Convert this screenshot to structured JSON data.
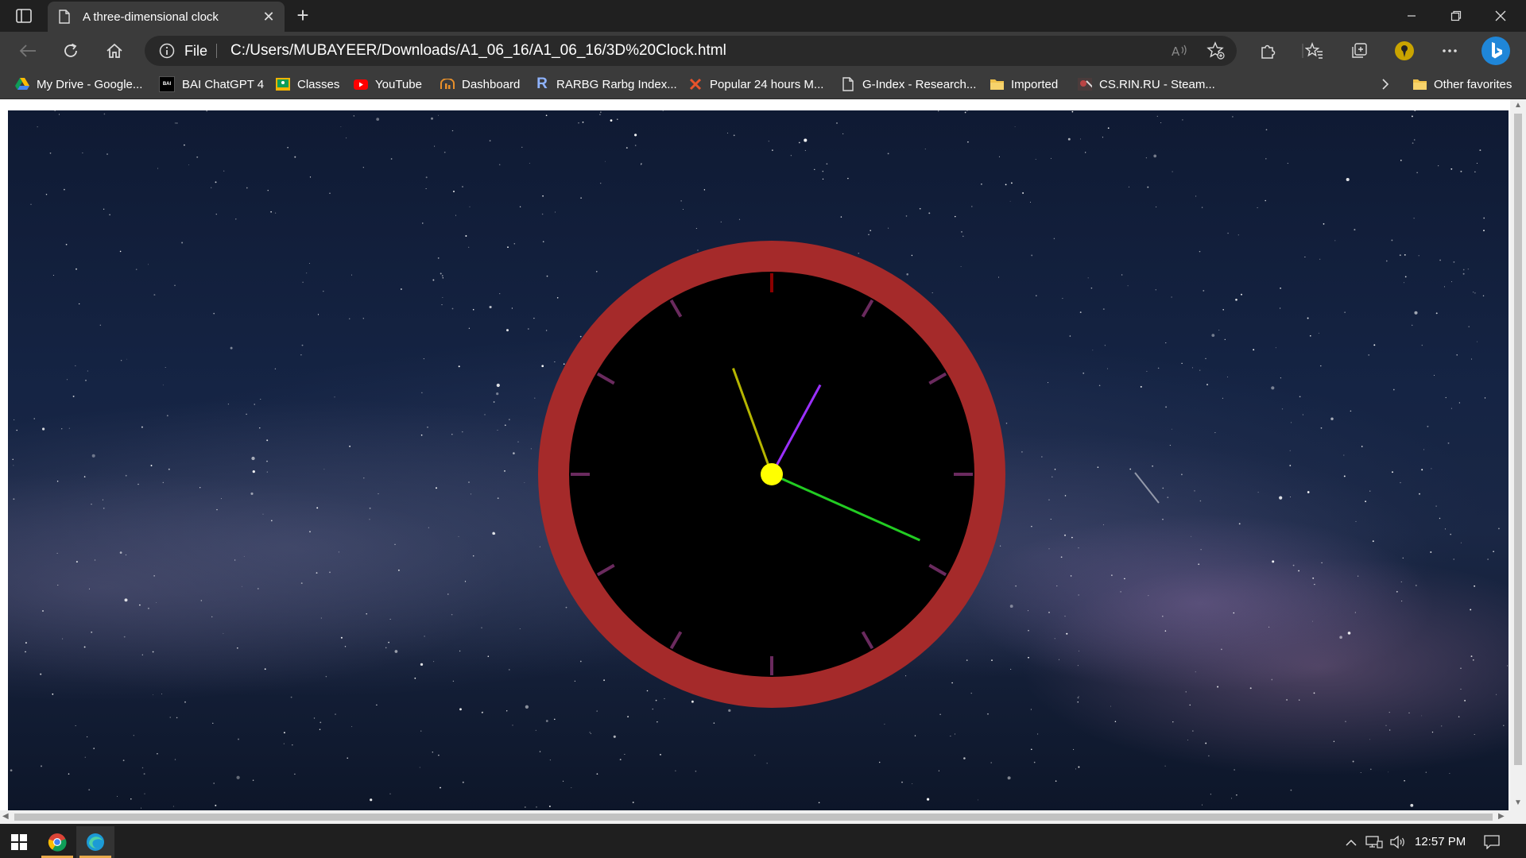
{
  "window": {
    "tab_title": "A three-dimensional clock",
    "tab_icon": "document-icon",
    "new_tab_symbol": "+"
  },
  "address_bar": {
    "scheme_label": "File",
    "url": "C:/Users/MUBAYEER/Downloads/A1_06_16/A1_06_16/3D%20Clock.html"
  },
  "favorites": [
    {
      "label": "My Drive - Google...",
      "icon": "google-drive-icon"
    },
    {
      "label": "BAI ChatGPT 4",
      "icon": "bai-icon",
      "badge": "BAI"
    },
    {
      "label": "Classes",
      "icon": "google-classroom-icon"
    },
    {
      "label": "YouTube",
      "icon": "youtube-icon"
    },
    {
      "label": "Dashboard",
      "icon": "dashboard-icon"
    },
    {
      "label": "RARBG Rarbg Index...",
      "icon": "rarbg-icon",
      "badge": "R"
    },
    {
      "label": "Popular 24 hours M...",
      "icon": "x-logo-icon"
    },
    {
      "label": "G-Index - Research...",
      "icon": "document-icon"
    },
    {
      "label": "Imported",
      "icon": "folder-icon"
    },
    {
      "label": "CS.RIN.RU - Steam...",
      "icon": "csrin-icon"
    }
  ],
  "other_favorites": "Other favorites",
  "clock": {
    "hour": 12,
    "minute": 57,
    "rim_color": "#a52a2a",
    "face_color": "#000000",
    "tick_color": "#6a2a5e",
    "twelve_tick_color": "#8b0000",
    "hour_hand_color": "#9b30ff",
    "minute_hand_color": "#b5b500",
    "second_hand_color": "#22cc22",
    "center_color": "#ffff00"
  },
  "taskbar": {
    "time": "12:57 PM",
    "apps": [
      "chrome-icon",
      "edge-icon"
    ]
  }
}
